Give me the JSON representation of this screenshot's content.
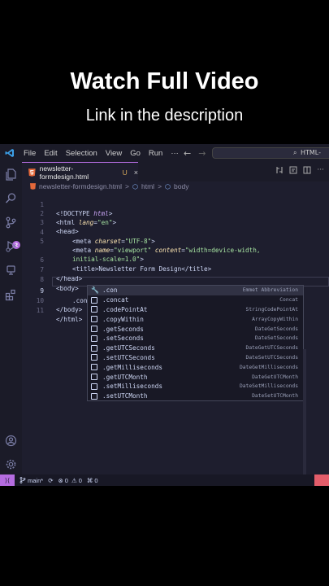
{
  "promo": {
    "title": "Watch Full Video",
    "subtitle": "Link in the description"
  },
  "menu": [
    "File",
    "Edit",
    "Selection",
    "View",
    "Go",
    "Run",
    "···"
  ],
  "nav": {
    "back": "←",
    "forward": "→"
  },
  "command_center": {
    "text": "HTML-"
  },
  "activity": {
    "scm_badge": "2"
  },
  "tab": {
    "name": "newsletter-formdesign.html",
    "status": "U",
    "close": "×"
  },
  "breadcrumb": {
    "file": "newsletter-formdesign.html",
    "node1": "html",
    "node2": "body",
    "sep": ">"
  },
  "lines": [
    {
      "n": "1"
    },
    {
      "n": "2"
    },
    {
      "n": "3"
    },
    {
      "n": "4"
    },
    {
      "n": "5"
    },
    {
      "n": ""
    },
    {
      "n": "6"
    },
    {
      "n": "7"
    },
    {
      "n": "8"
    },
    {
      "n": "9"
    },
    {
      "n": "10"
    },
    {
      "n": "11"
    }
  ],
  "code": {
    "l1_a": "<!DOCTYPE ",
    "l1_b": "html",
    "l1_c": ">",
    "l2_a": "<html ",
    "l2_b": "lang",
    "l2_c": "=",
    "l2_d": "\"en\"",
    "l2_e": ">",
    "l3": "<head>",
    "l4_a": "<meta ",
    "l4_b": "charset",
    "l4_c": "=",
    "l4_d": "\"UTF-8\"",
    "l4_e": ">",
    "l5_a": "<meta ",
    "l5_b": "name",
    "l5_c": "=",
    "l5_d": "\"viewport\"",
    "l5_e": " content",
    "l5_f": "=",
    "l5_g": "\"width=device-width,",
    "l5w": "initial-scale=1.0\"",
    "l5w_b": ">",
    "l6_a": "<title>",
    "l6_b": "Newsletter Form Design",
    "l6_c": "</title>",
    "l7": "</head>",
    "l8": "<body>",
    "l9": ".con",
    "l10": "</body>",
    "l11": "</html>"
  },
  "suggestions": [
    {
      "label": ".con",
      "detail": "Emmet Abbreviation"
    },
    {
      "label": ".concat",
      "detail": "Concat"
    },
    {
      "label": ".codePointAt",
      "detail": "StringCodePointAt"
    },
    {
      "label": ".copyWithin",
      "detail": "ArrayCopyWithin"
    },
    {
      "label": ".getSeconds",
      "detail": "DateGetSeconds"
    },
    {
      "label": ".setSeconds",
      "detail": "DateSetSeconds"
    },
    {
      "label": ".getUTCSeconds",
      "detail": "DateGetUTCSeconds"
    },
    {
      "label": ".setUTCSeconds",
      "detail": "DateSetUTCSeconds"
    },
    {
      "label": ".getMilliseconds",
      "detail": "DateGetMilliseconds"
    },
    {
      "label": ".getUTCMonth",
      "detail": "DateGetUTCMonth"
    },
    {
      "label": ".setMilliseconds",
      "detail": "DateSetMilliseconds"
    },
    {
      "label": ".setUTCMonth",
      "detail": "DateSetUTCMonth"
    }
  ],
  "status": {
    "branch": "main*",
    "errors": "0",
    "warnings": "0",
    "ports": "0"
  },
  "colors": {
    "accent": "#b56ce0",
    "editor_bg": "#1e1e2e",
    "bell": "#e35d6a"
  }
}
